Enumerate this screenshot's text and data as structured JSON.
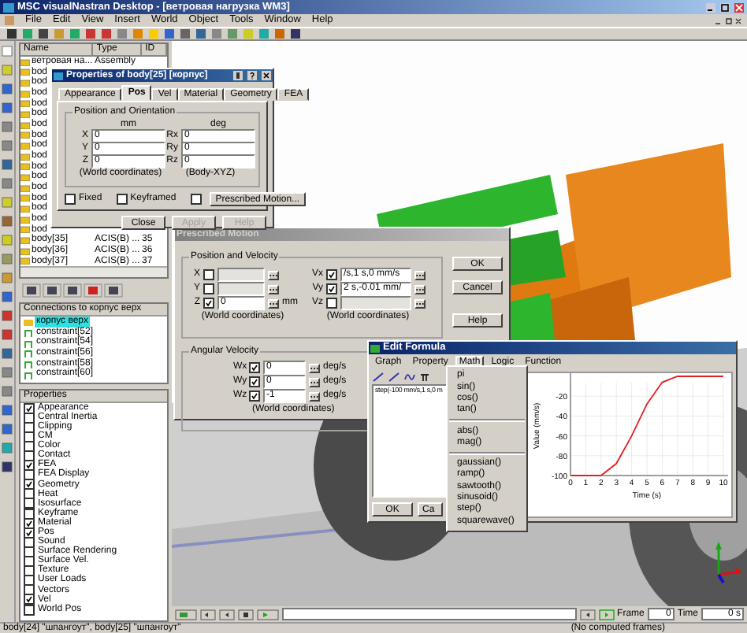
{
  "window": {
    "title": "MSC visualNastran Desktop - [ветровая нагрузка WM3]"
  },
  "menu": [
    "File",
    "Edit",
    "View",
    "Insert",
    "World",
    "Object",
    "Tools",
    "Window",
    "Help"
  ],
  "object_list": {
    "columns": [
      "Name",
      "Type",
      "ID"
    ],
    "rows": [
      {
        "name": "ветровая на...",
        "type": "Assembly"
      },
      {
        "name": "bod"
      },
      {
        "name": "bod"
      },
      {
        "name": "bod"
      },
      {
        "name": "bod"
      },
      {
        "name": "bod"
      },
      {
        "name": "bod"
      },
      {
        "name": "bod"
      },
      {
        "name": "bod"
      },
      {
        "name": "bod"
      },
      {
        "name": "bod"
      },
      {
        "name": "bod"
      },
      {
        "name": "bod"
      },
      {
        "name": "bod"
      },
      {
        "name": "bod"
      },
      {
        "name": "bod"
      },
      {
        "name": "bod"
      },
      {
        "name": "body[35]",
        "type": "ACIS(B) ...",
        "id": "35"
      },
      {
        "name": "body[36]",
        "type": "ACIS(B) ...",
        "id": "36"
      },
      {
        "name": "body[37]",
        "type": "ACIS(B) ...",
        "id": "37"
      }
    ]
  },
  "connections": {
    "title": "Connections to корпус верх",
    "items": [
      {
        "name": "корпус верх",
        "kind": "body",
        "selected": true
      },
      {
        "name": "constraint[52]",
        "kind": "constraint",
        "selected": false
      },
      {
        "name": "constraint[54]",
        "kind": "constraint",
        "selected": false
      },
      {
        "name": "constraint[56]",
        "kind": "constraint",
        "selected": false
      },
      {
        "name": "constraint[58]",
        "kind": "constraint",
        "selected": false
      },
      {
        "name": "constraint[60]",
        "kind": "constraint",
        "selected": false
      }
    ]
  },
  "properties_panel": {
    "title": "Properties",
    "items": [
      {
        "label": "Appearance",
        "checked": true
      },
      {
        "label": "Central Inertia",
        "checked": false
      },
      {
        "label": "Clipping",
        "checked": false
      },
      {
        "label": "CM",
        "checked": false
      },
      {
        "label": "Color",
        "checked": false
      },
      {
        "label": "Contact",
        "checked": false
      },
      {
        "label": "FEA",
        "checked": true
      },
      {
        "label": "FEA Display",
        "checked": false
      },
      {
        "label": "Geometry",
        "checked": true
      },
      {
        "label": "Heat",
        "checked": false
      },
      {
        "label": "Isosurface",
        "checked": false
      },
      {
        "label": "Keyframe",
        "checked": false
      },
      {
        "label": "Material",
        "checked": true
      },
      {
        "label": "Pos",
        "checked": true
      },
      {
        "label": "Sound",
        "checked": false
      },
      {
        "label": "Surface Rendering",
        "checked": false
      },
      {
        "label": "Surface Vel.",
        "checked": false
      },
      {
        "label": "Texture",
        "checked": false
      },
      {
        "label": "User Loads",
        "checked": false
      },
      {
        "label": "Vectors",
        "checked": false
      },
      {
        "label": "Vel",
        "checked": true
      },
      {
        "label": "World Pos",
        "checked": false
      }
    ]
  },
  "properties_dialog": {
    "title": "Properties of body[25] [корпус]",
    "tabs": [
      {
        "label": "Appearance",
        "selected": false
      },
      {
        "label": "Pos",
        "selected": true
      },
      {
        "label": "Vel",
        "selected": false
      },
      {
        "label": "Material",
        "selected": false
      },
      {
        "label": "Geometry",
        "selected": false
      },
      {
        "label": "FEA",
        "selected": false
      }
    ],
    "group": "Position and Orientation",
    "position": {
      "unit": "mm",
      "fields": [
        {
          "label": "X",
          "value": "0"
        },
        {
          "label": "Y",
          "value": "0"
        },
        {
          "label": "Z",
          "value": "0"
        }
      ],
      "note": "(World coordinates)"
    },
    "orientation": {
      "unit": "deg",
      "fields": [
        {
          "label": "Rx",
          "value": "0"
        },
        {
          "label": "Ry",
          "value": "0"
        },
        {
          "label": "Rz",
          "value": "0"
        }
      ],
      "note": "(Body-XYZ)"
    },
    "checks": [
      {
        "label": "Fixed",
        "checked": false
      },
      {
        "label": "Keyframed",
        "checked": false
      }
    ],
    "prescribed_checked": false,
    "prescribed_button": "Prescribed Motion...",
    "buttons": [
      {
        "label": "Close",
        "disabled": false
      },
      {
        "label": "Apply",
        "disabled": true
      },
      {
        "label": "Help",
        "disabled": true
      }
    ]
  },
  "prescribed_motion": {
    "title": "Prescribed Motion",
    "group": "Position and Velocity",
    "position": [
      {
        "label": "X",
        "checked": false
      },
      {
        "label": "Y",
        "checked": false
      },
      {
        "label": "Z",
        "checked": true,
        "value": "0",
        "unit": "mm"
      }
    ],
    "position_note": "(World coordinates)",
    "velocity": [
      {
        "label": "Vx",
        "checked": true,
        "value": "/s,1 s,0 mm/s"
      },
      {
        "label": "Vy",
        "checked": true,
        "value": "2 s,-0.01 mm/"
      },
      {
        "label": "Vz",
        "checked": false
      }
    ],
    "velocity_note": "(World coordinates)",
    "angular_group": "Angular Velocity",
    "angular": [
      {
        "label": "Wx",
        "checked": true,
        "value": "0",
        "unit": "deg/s"
      },
      {
        "label": "Wy",
        "checked": true,
        "value": "0",
        "unit": "deg/s"
      },
      {
        "label": "Wz",
        "checked": true,
        "value": "-1",
        "unit": "deg/s"
      }
    ],
    "angular_note": "(World coordinates)",
    "buttons": [
      "OK",
      "Cancel",
      "Help"
    ]
  },
  "edit_formula": {
    "title": "Edit Formula",
    "tabs": [
      {
        "label": "Graph",
        "selected": false
      },
      {
        "label": "Property",
        "selected": false
      },
      {
        "label": "Math",
        "selected": true
      },
      {
        "label": "Logic",
        "selected": false
      },
      {
        "label": "Function",
        "selected": false
      }
    ],
    "formula": "step(-100 mm/s,1 s,0 m",
    "buttons": [
      "OK",
      "Ca"
    ],
    "chart_data": {
      "type": "line",
      "xlabel": "Time (s)",
      "ylabel": "Value (mm/s)",
      "x": [
        0,
        1,
        2,
        3,
        4,
        5,
        6,
        7,
        8,
        9,
        10
      ],
      "grid": true,
      "series": [
        {
          "color": "#e02020",
          "values": [
            -100,
            -100,
            -100,
            -88,
            -60,
            -28,
            -6,
            0,
            0,
            0,
            0
          ]
        }
      ],
      "xlim": [
        0,
        10
      ],
      "ylim": [
        -100,
        0
      ],
      "xticks": [
        0,
        1,
        2,
        3,
        4,
        5,
        6,
        7,
        8,
        9,
        10
      ],
      "yticks": [
        -100,
        -80,
        -60,
        -40,
        -20
      ]
    },
    "math_menu": [
      [
        "pi",
        "sin()",
        "cos()",
        "tan()"
      ],
      [
        "abs()",
        "mag()"
      ],
      [
        "gaussian()",
        "ramp()",
        "sawtooth()",
        "sinusoid()",
        "step()",
        "squarewave()"
      ]
    ]
  },
  "playback": {
    "frame_label": "Frame",
    "frame": "0",
    "time_label": "Time",
    "time": "0 s",
    "note": "(No computed frames)"
  },
  "status_bar": "body[24] \"шпангоут\", body[25] \"шпангоут\""
}
